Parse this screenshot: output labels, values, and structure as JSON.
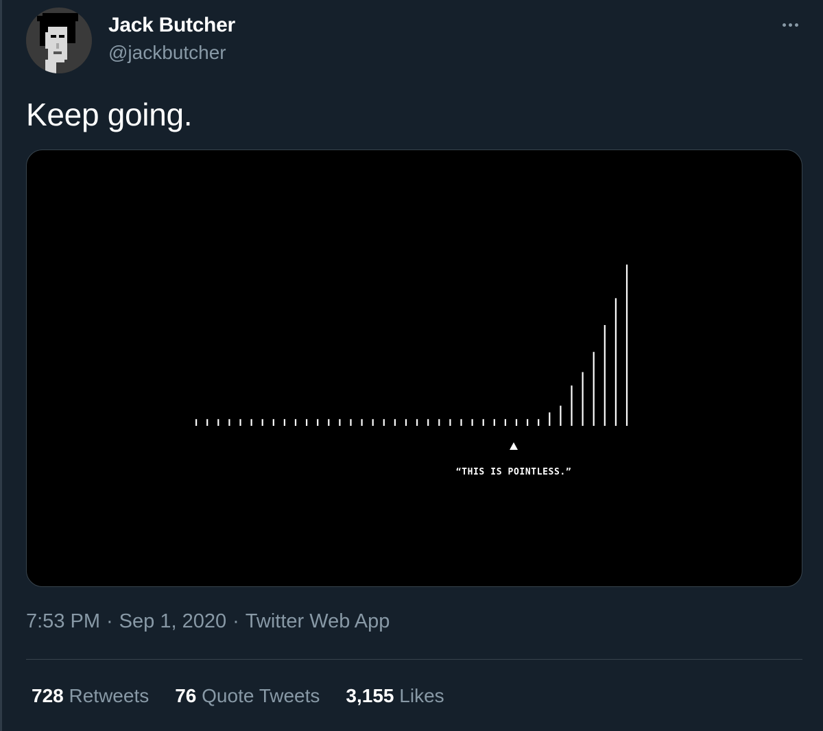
{
  "tweet": {
    "author": {
      "display_name": "Jack Butcher",
      "handle": "@jackbutcher",
      "avatar_icon": "pixel-portrait-avatar"
    },
    "more_icon": "more-options-icon",
    "text": "Keep going.",
    "media": {
      "annotation": "“THIS IS POINTLESS.”",
      "marker_icon": "triangle-up-icon"
    },
    "meta": {
      "time": "7:53 PM",
      "separator": "·",
      "date": "Sep 1, 2020",
      "source": "Twitter Web App"
    },
    "stats": [
      {
        "count": "728",
        "label": "Retweets"
      },
      {
        "count": "76",
        "label": "Quote Tweets"
      },
      {
        "count": "3,155",
        "label": "Likes"
      }
    ]
  },
  "colors": {
    "background": "#15202b",
    "text_primary": "#ffffff",
    "text_secondary": "#8899a6",
    "border": "#38444d",
    "media_background": "#000000"
  },
  "chart_data": {
    "type": "bar",
    "values": [
      1,
      1,
      1,
      1,
      1,
      1,
      1,
      1,
      1,
      1,
      1,
      1,
      1,
      1,
      1,
      1,
      1,
      1,
      1,
      1,
      1,
      1,
      1,
      1,
      1,
      1,
      1,
      1,
      1,
      1,
      1,
      1,
      2,
      3,
      6,
      8,
      11,
      15,
      19,
      24
    ],
    "marker_index": 29,
    "annotation": "“THIS IS POINTLESS.”"
  }
}
